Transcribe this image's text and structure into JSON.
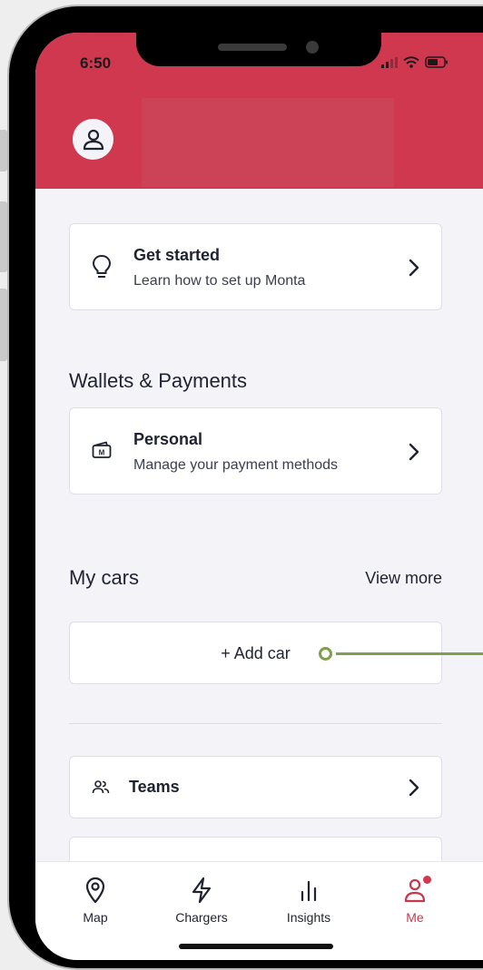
{
  "status_bar": {
    "time": "6:50"
  },
  "get_started": {
    "title": "Get started",
    "subtitle": "Learn how to set up Monta"
  },
  "wallets": {
    "section_title": "Wallets & Payments",
    "card": {
      "title": "Personal",
      "subtitle": "Manage your payment methods",
      "icon_text": "M"
    }
  },
  "cars": {
    "section_title": "My cars",
    "view_more": "View more",
    "add_car": "+ Add car"
  },
  "menu": {
    "teams": "Teams"
  },
  "tabbar": {
    "items": [
      {
        "label": "Map",
        "icon": "location-pin-icon"
      },
      {
        "label": "Chargers",
        "icon": "lightning-icon"
      },
      {
        "label": "Insights",
        "icon": "bar-chart-icon"
      },
      {
        "label": "Me",
        "icon": "person-icon"
      }
    ],
    "active": "Me"
  },
  "colors": {
    "brand": "#d0384f",
    "annotation": "#7f9e4e",
    "background": "#f4f4f8"
  }
}
